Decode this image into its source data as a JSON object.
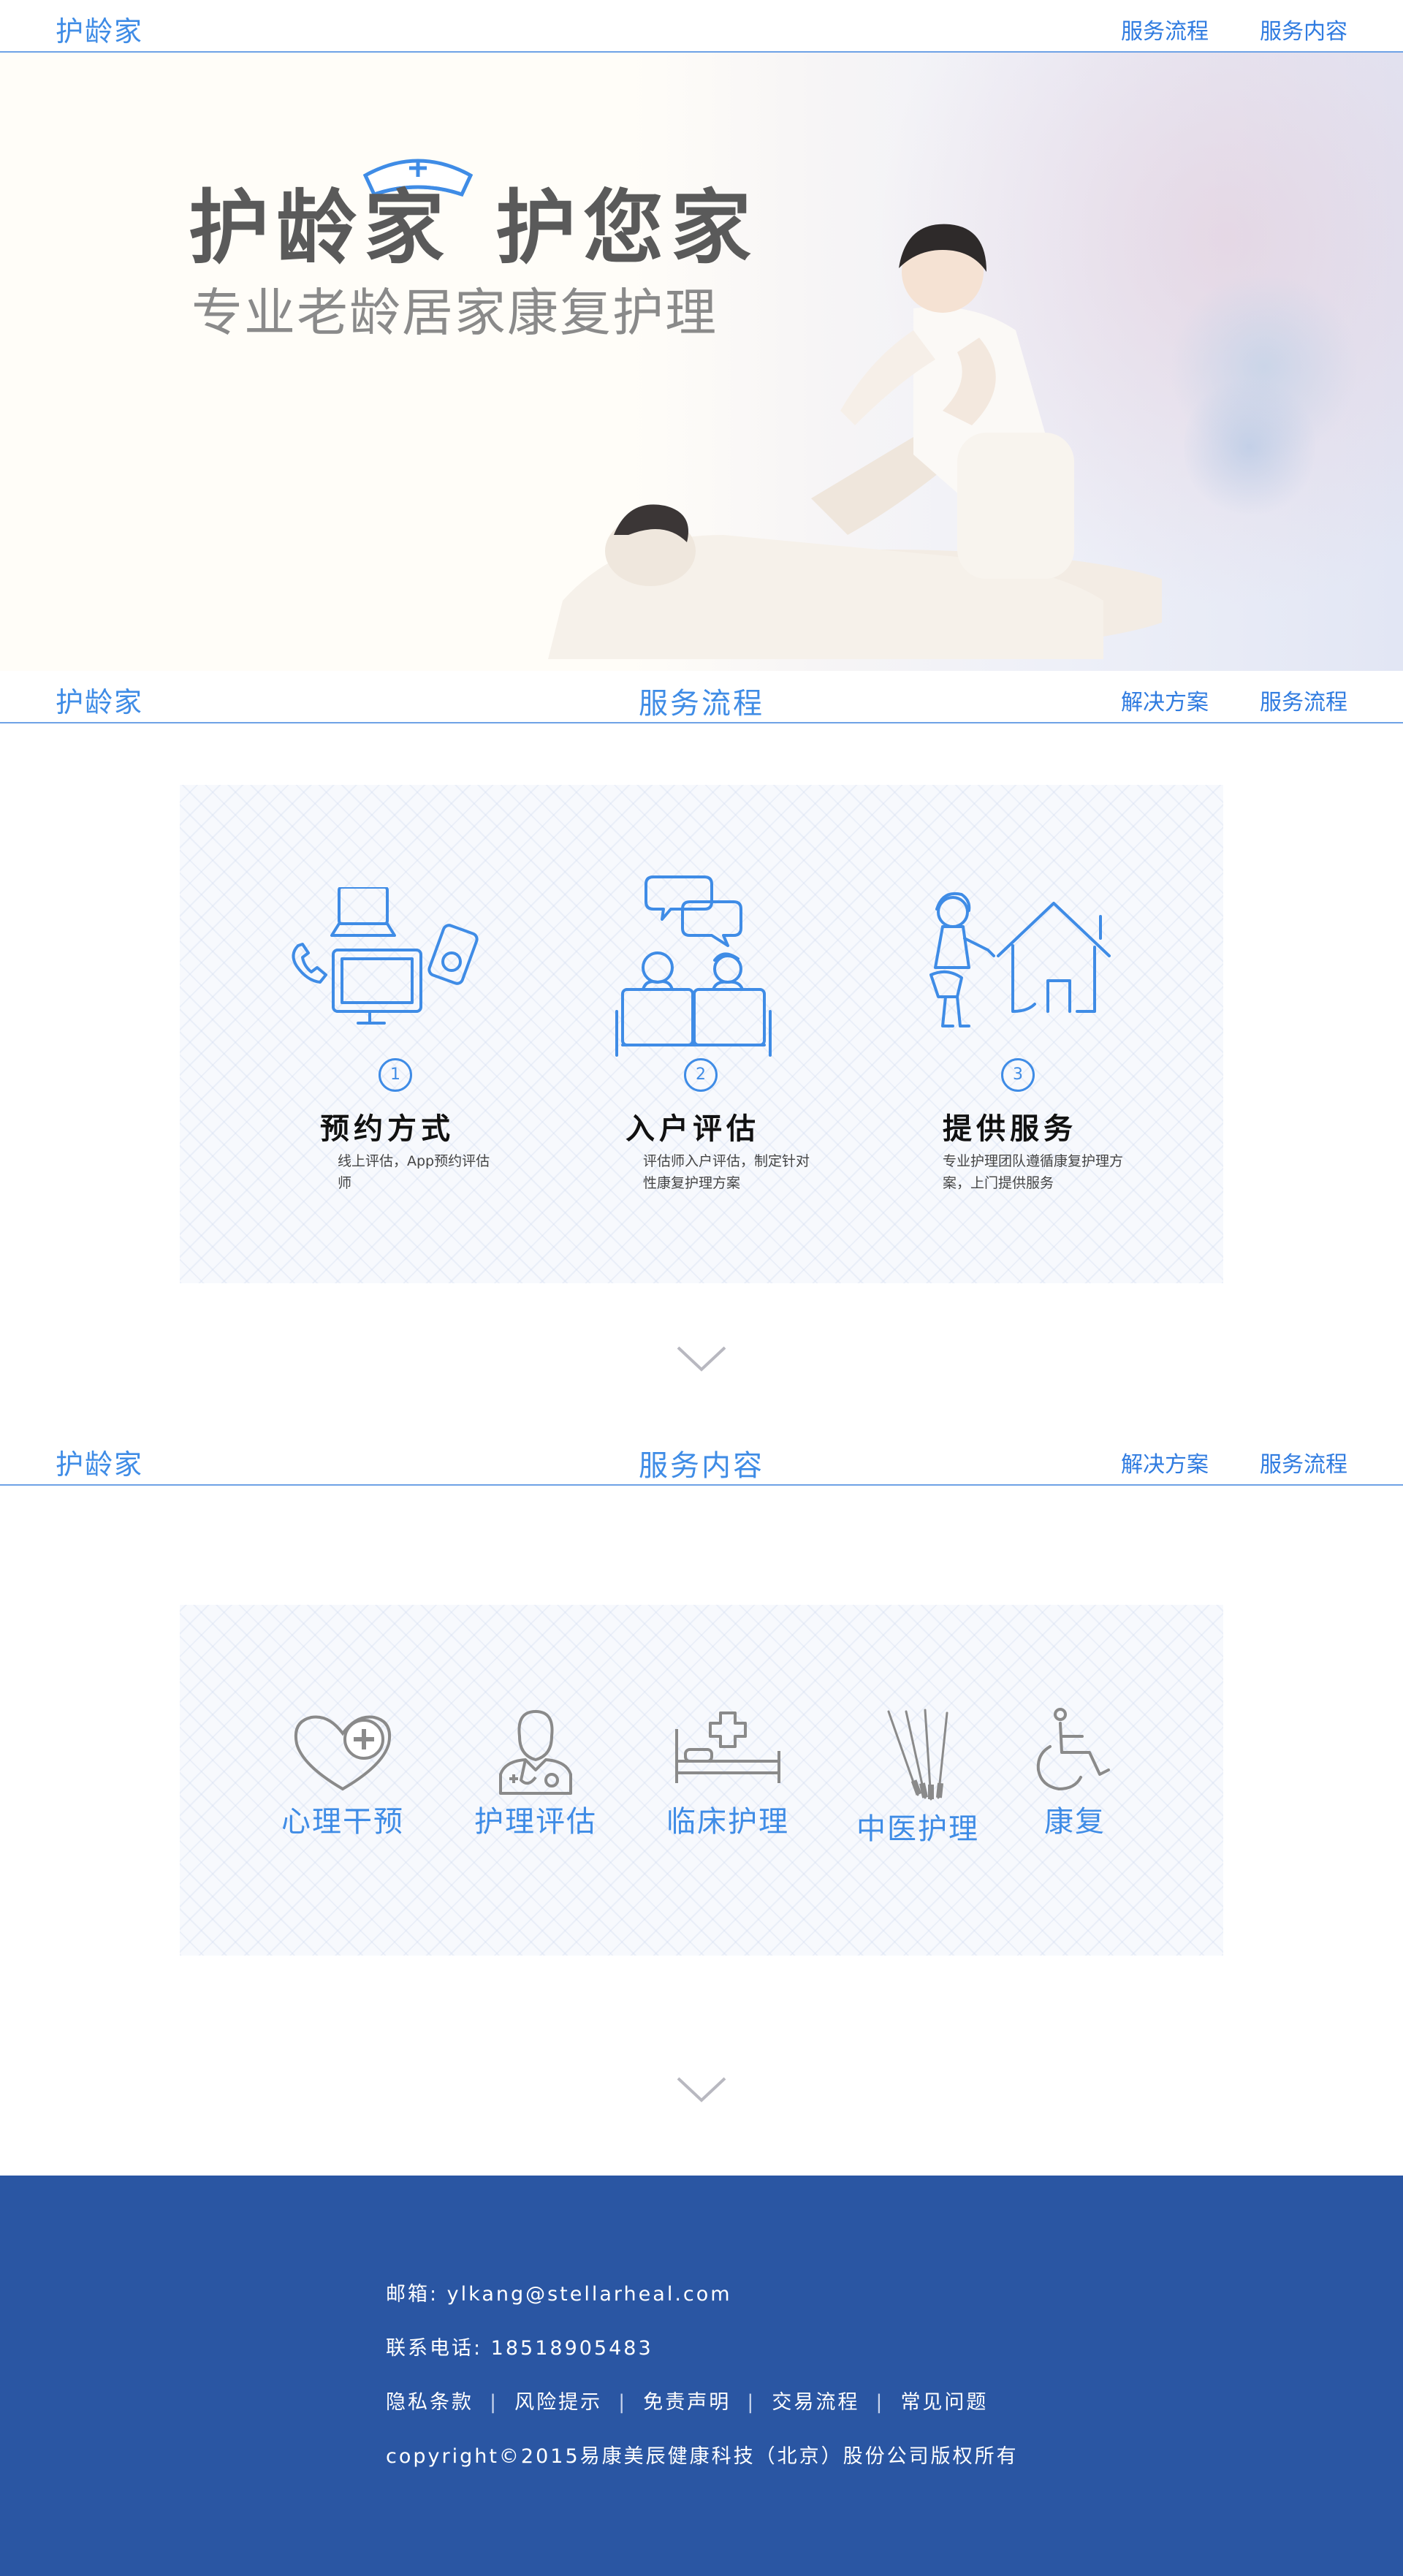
{
  "top_nav": {
    "brand": "护龄家",
    "links": [
      "服务流程",
      "服务内容"
    ]
  },
  "hero": {
    "title_part1": "护龄家",
    "title_part2": "护您家",
    "subtitle": "专业老龄居家康复护理"
  },
  "flow_nav": {
    "brand": "护龄家",
    "title": "服务流程",
    "links": [
      "解决方案",
      "服务流程"
    ]
  },
  "flow_steps": [
    {
      "num": "1",
      "title": "预约方式",
      "desc": "线上评估，App预约评估师",
      "icon": "devices-icon"
    },
    {
      "num": "2",
      "title": "入户评估",
      "desc": "评估师入户评估，制定针对性康复护理方案",
      "icon": "consultation-icon"
    },
    {
      "num": "3",
      "title": "提供服务",
      "desc": "专业护理团队遵循康复护理方案，上门提供服务",
      "icon": "home-visit-icon"
    }
  ],
  "content_nav": {
    "brand": "护龄家",
    "title": "服务内容",
    "links": [
      "解决方案",
      "服务流程"
    ]
  },
  "services": [
    {
      "label": "心理干预",
      "icon": "heart-plus-icon"
    },
    {
      "label": "护理评估",
      "icon": "doctor-icon"
    },
    {
      "label": "临床护理",
      "icon": "hospital-bed-icon"
    },
    {
      "label": "中医护理",
      "icon": "acupuncture-icon"
    },
    {
      "label": "康复",
      "icon": "wheelchair-icon"
    }
  ],
  "footer": {
    "email": "邮箱: ylkang@stellarheal.com",
    "phone": "联系电话: 18518905483",
    "links": [
      "隐私条款",
      "风险提示",
      "免责声明",
      "交易流程",
      "常见问题"
    ],
    "copyright": "copyright©2015易康美辰健康科技（北京）股份公司版权所有"
  },
  "colors": {
    "accent": "#3f8ce6",
    "footer_bg": "#2a56a3"
  }
}
